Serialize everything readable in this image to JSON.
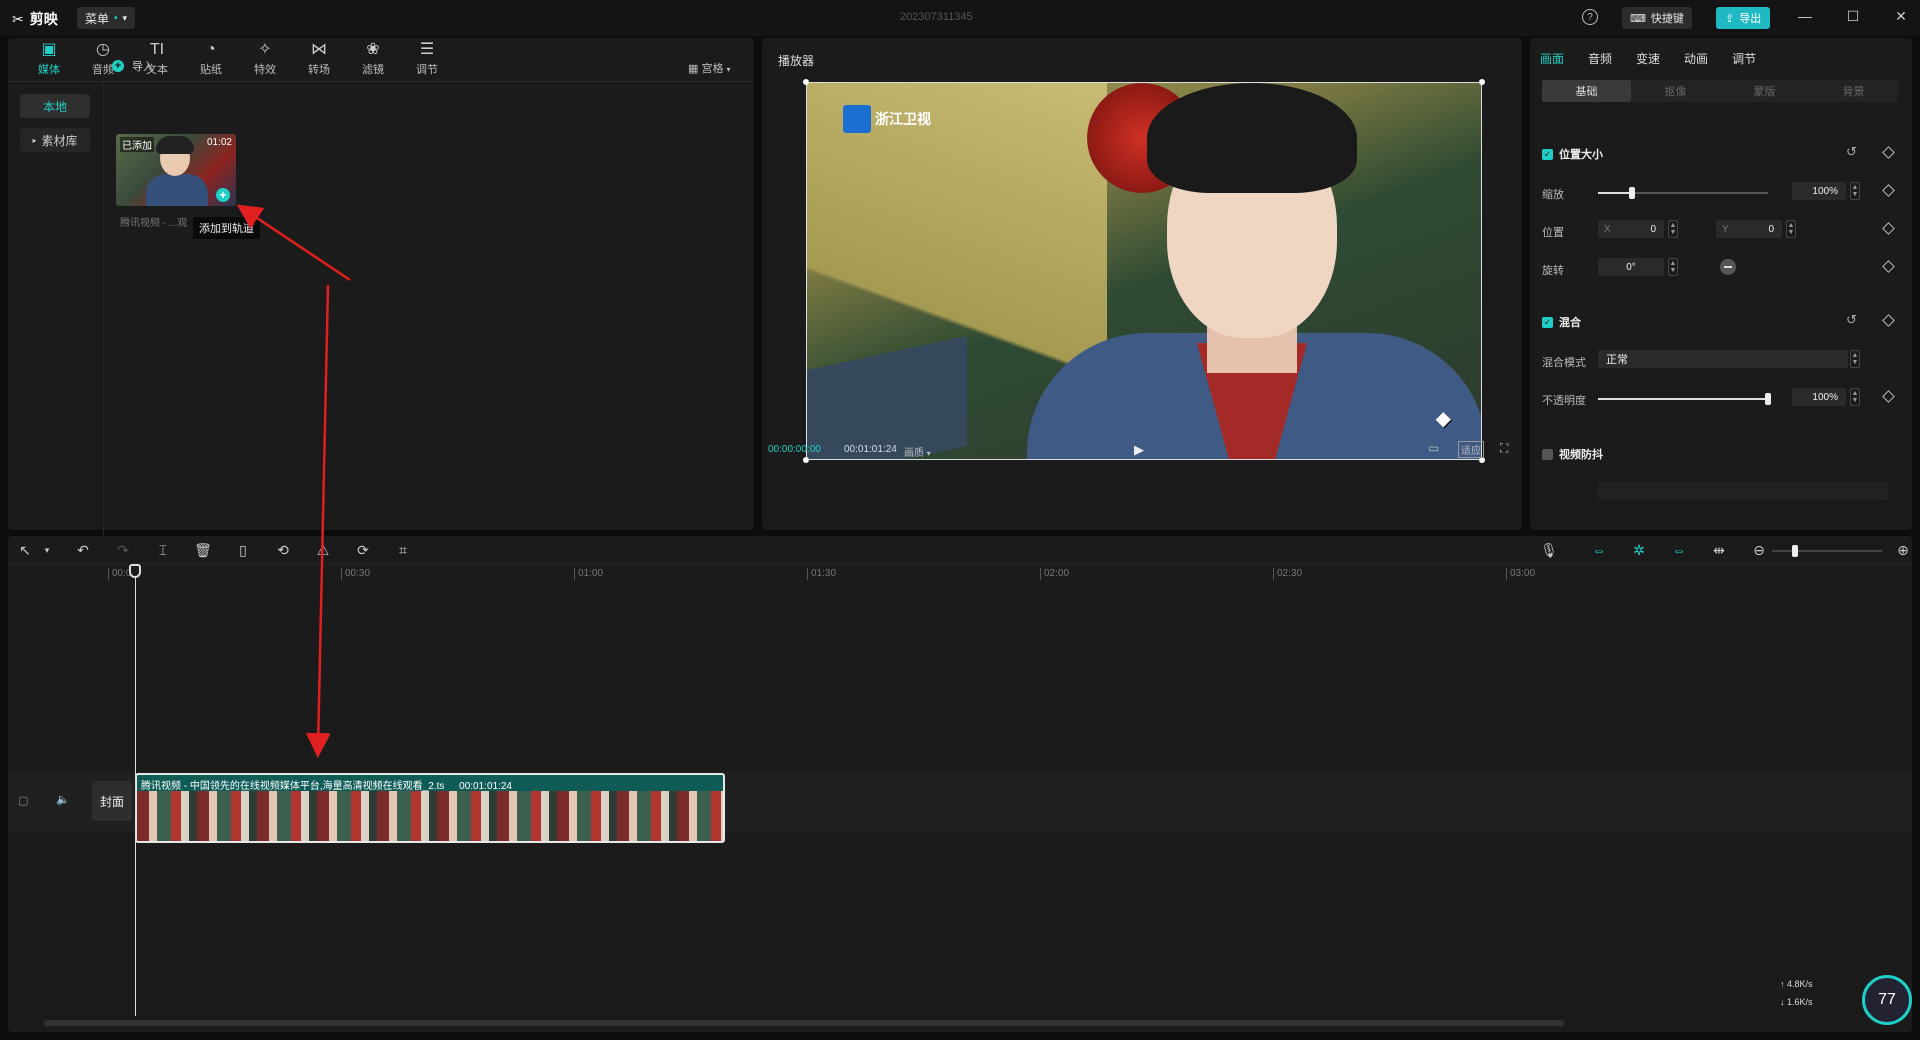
{
  "titlebar": {
    "app_name": "剪映",
    "menu_label": "菜单",
    "project_title": "202307311345",
    "help_glyph": "?",
    "shortcut_label": "快捷键",
    "export_label": "导出"
  },
  "media_panel": {
    "tabs": [
      {
        "label": "媒体",
        "icon": "media-icon",
        "glyph": "▣"
      },
      {
        "label": "音频",
        "icon": "audio-icon",
        "glyph": "◷"
      },
      {
        "label": "文本",
        "icon": "text-icon",
        "glyph": "TI"
      },
      {
        "label": "贴纸",
        "icon": "sticker-icon",
        "glyph": "◔"
      },
      {
        "label": "特效",
        "icon": "effects-icon",
        "glyph": "✧"
      },
      {
        "label": "转场",
        "icon": "transition-icon",
        "glyph": "⋈"
      },
      {
        "label": "滤镜",
        "icon": "filter-icon",
        "glyph": "❀"
      },
      {
        "label": "调节",
        "icon": "adjust-icon",
        "glyph": "☰"
      }
    ],
    "side": {
      "local": "本地",
      "library": "素材库"
    },
    "import_label": "导入",
    "sort_label": "宫格",
    "clip": {
      "added_badge": "已添加",
      "duration": "01:02",
      "name": "腾讯视频 - ...观",
      "tooltip": "添加到轨道"
    }
  },
  "player": {
    "title": "播放器",
    "watermark_logo": "浙江卫视",
    "current_time": "00:00:00:00",
    "total_time": "00:01:01:24",
    "quality_label": "画质",
    "ratio_label": "适应"
  },
  "properties": {
    "tabs": [
      "画面",
      "音频",
      "变速",
      "动画",
      "调节"
    ],
    "subtabs": [
      "基础",
      "抠像",
      "蒙版",
      "背景"
    ],
    "position_size": {
      "title": "位置大小",
      "scale_label": "缩放",
      "scale_value": "100%",
      "scale_level": 0.2,
      "position_label": "位置",
      "x_prefix": "X",
      "x_value": "0",
      "y_prefix": "Y",
      "y_value": "0",
      "rotate_label": "旋转",
      "rotate_value": "0°"
    },
    "blend": {
      "title": "混合",
      "mode_label": "混合模式",
      "mode_value": "正常",
      "opacity_label": "不透明度",
      "opacity_value": "100%",
      "opacity_level": 1.0
    },
    "stabilize": {
      "title": "视频防抖"
    },
    "accent_color": "#1fd0c7"
  },
  "timeline": {
    "ticks": [
      "00:00",
      "00:30",
      "01:00",
      "01:30",
      "02:00",
      "02:30",
      "03:00"
    ],
    "cover_label": "封面",
    "clip_title": "腾讯视频 - 中国领先的在线视频媒体平台,海量高清视频在线观看_2.ts",
    "clip_duration": "00:01:01:24"
  },
  "netwidget": {
    "up": "4.8",
    "up_unit": "K/s",
    "down": "1.6",
    "down_unit": "K/s",
    "gauge": "77"
  }
}
